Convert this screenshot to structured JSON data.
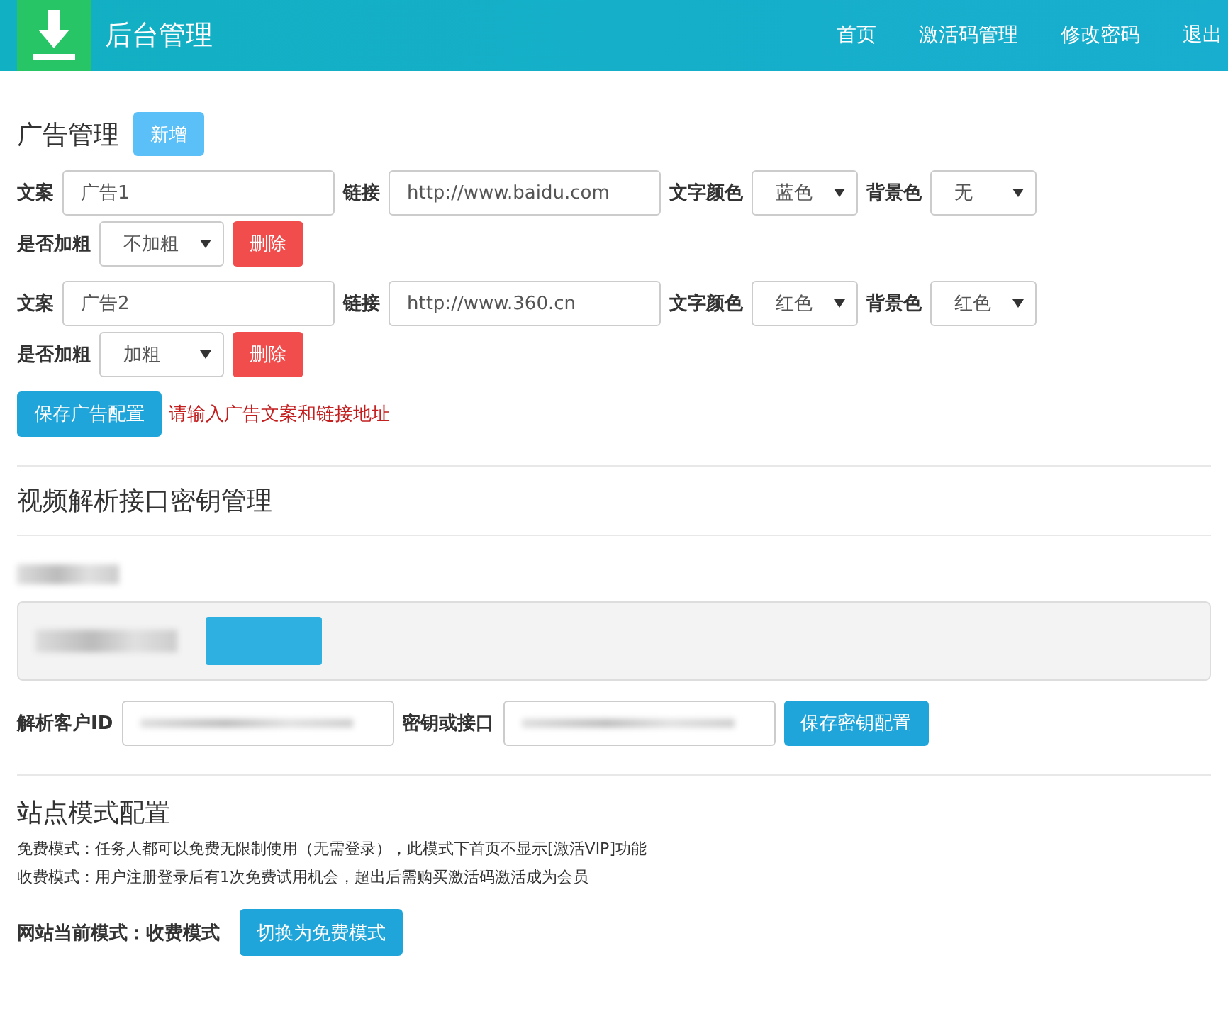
{
  "header": {
    "title": "后台管理",
    "nav": [
      {
        "label": "首页"
      },
      {
        "label": "激活码管理"
      },
      {
        "label": "修改密码"
      },
      {
        "label": "退出"
      }
    ]
  },
  "ads": {
    "title": "广告管理",
    "add_button": "新增",
    "items": [
      {
        "fields": [
          {
            "kind": "input",
            "label": "文案",
            "value": "广告1"
          },
          {
            "kind": "input",
            "label": "链接",
            "value": "http://www.baidu.com"
          },
          {
            "kind": "select",
            "label": "文字颜色",
            "value": "蓝色"
          },
          {
            "kind": "select",
            "label": "背景色",
            "value": "无"
          },
          {
            "kind": "select",
            "label": "是否加粗",
            "value": "不加粗"
          }
        ],
        "delete_button": "删除"
      },
      {
        "fields": [
          {
            "kind": "input",
            "label": "文案",
            "value": "广告2"
          },
          {
            "kind": "input",
            "label": "链接",
            "value": "http://www.360.cn"
          },
          {
            "kind": "select",
            "label": "文字颜色",
            "value": "红色"
          },
          {
            "kind": "select",
            "label": "背景色",
            "value": "红色"
          },
          {
            "kind": "select",
            "label": "是否加粗",
            "value": "加粗"
          }
        ],
        "delete_button": "删除"
      }
    ],
    "save_button": "保存广告配置",
    "hint": "请输入广告文案和链接地址"
  },
  "video": {
    "title": "视频解析接口密钥管理",
    "fields": [
      {
        "label": "解析客户ID"
      },
      {
        "label": "密钥或接口"
      }
    ],
    "save_button": "保存密钥配置"
  },
  "mode": {
    "title": "站点模式配置",
    "notes": [
      "免费模式：任务人都可以免费无限制使用（无需登录），此模式下首页不显示[激活VIP]功能",
      "收费模式：用户注册登录后有1次免费试用机会，超出后需购买激活码激活成为会员"
    ],
    "current": "网站当前模式：收费模式",
    "switch_button": "切换为免费模式"
  }
}
